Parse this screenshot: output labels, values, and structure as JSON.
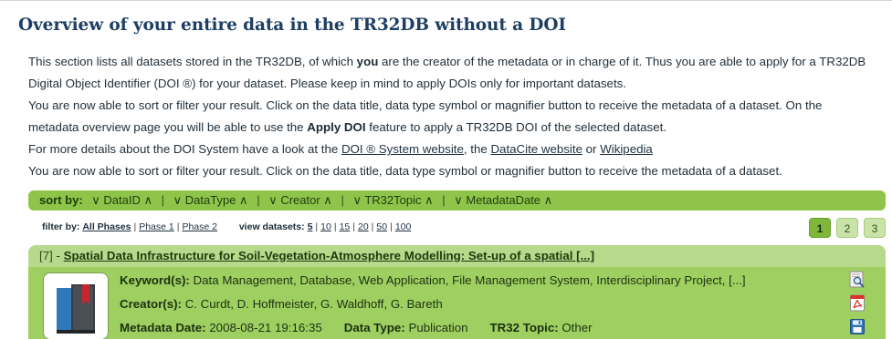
{
  "title": "Overview of your entire data in the TR32DB without a DOI",
  "intro": {
    "l1_pre": "This section lists all datasets stored in the TR32DB, of which ",
    "l1_bold": "you",
    "l1_post": " are the creator of the metadata or in charge of it. Thus you are able to apply for a TR32DB",
    "l2": "Digital Object Identifier (DOI ®) for your dataset. Please keep in mind to apply DOIs only for important datasets.",
    "l3": "You are now able to sort or filter your result. Click on the data title, data type symbol or magnifier button to receive the metadata of a dataset. On the",
    "l4_pre": "metadata overview page you will be able to use the ",
    "l4_bold": "Apply DOI",
    "l4_post": " feature to apply a TR32DB DOI of the selected dataset.",
    "l5_pre": "For more details about the DOI System have a look at the ",
    "l5_link1": "DOI ® System website",
    "l5_mid1": ", the ",
    "l5_link2": "DataCite website",
    "l5_mid2": " or ",
    "l5_link3": "Wikipedia",
    "l6": "You are now able to sort or filter your result. Click on the data title, data type symbol or magnifier button to receive the metadata of a dataset."
  },
  "sort": {
    "label": "sort by:",
    "options": [
      "∨ DataID ∧",
      "∨ DataType ∧",
      "∨ Creator ∧",
      "∨ TR32Topic ∧",
      "∨ MetadataDate ∧"
    ],
    "separator": "|"
  },
  "filter": {
    "label": "filter by:",
    "phases": [
      "All Phases",
      "Phase 1",
      "Phase 2"
    ],
    "view_label": "view datasets:",
    "counts": [
      "5",
      "10",
      "15",
      "20",
      "50",
      "100"
    ]
  },
  "pager": {
    "pages": [
      "1",
      "2",
      "3"
    ],
    "active": "1"
  },
  "record": {
    "id": "[7]",
    "dash": " - ",
    "title": "Spatial Data Infrastructure for Soil-Vegetation-Atmosphere Modelling: Set-up of a spatial [...]",
    "keywords_label": "Keyword(s):",
    "keywords": "Data Management, Database, Web Application, File Management System, Interdisciplinary Project, [...]",
    "creators_label": "Creator(s):",
    "creators": "C. Curdt, D. Hoffmeister, G. Waldhoff, G. Bareth",
    "date_label": "Metadata Date:",
    "date": "2008-08-21 19:16:35",
    "type_label": "Data Type:",
    "type": "Publication",
    "topic_label": "TR32 Topic:",
    "topic": "Other"
  },
  "colors": {
    "accent": "#8fc44a",
    "title": "#1e3f63",
    "record_bg": "#9fcf61"
  },
  "icons": [
    "book-icon",
    "magnifier-icon",
    "pdf-icon",
    "save-icon"
  ]
}
